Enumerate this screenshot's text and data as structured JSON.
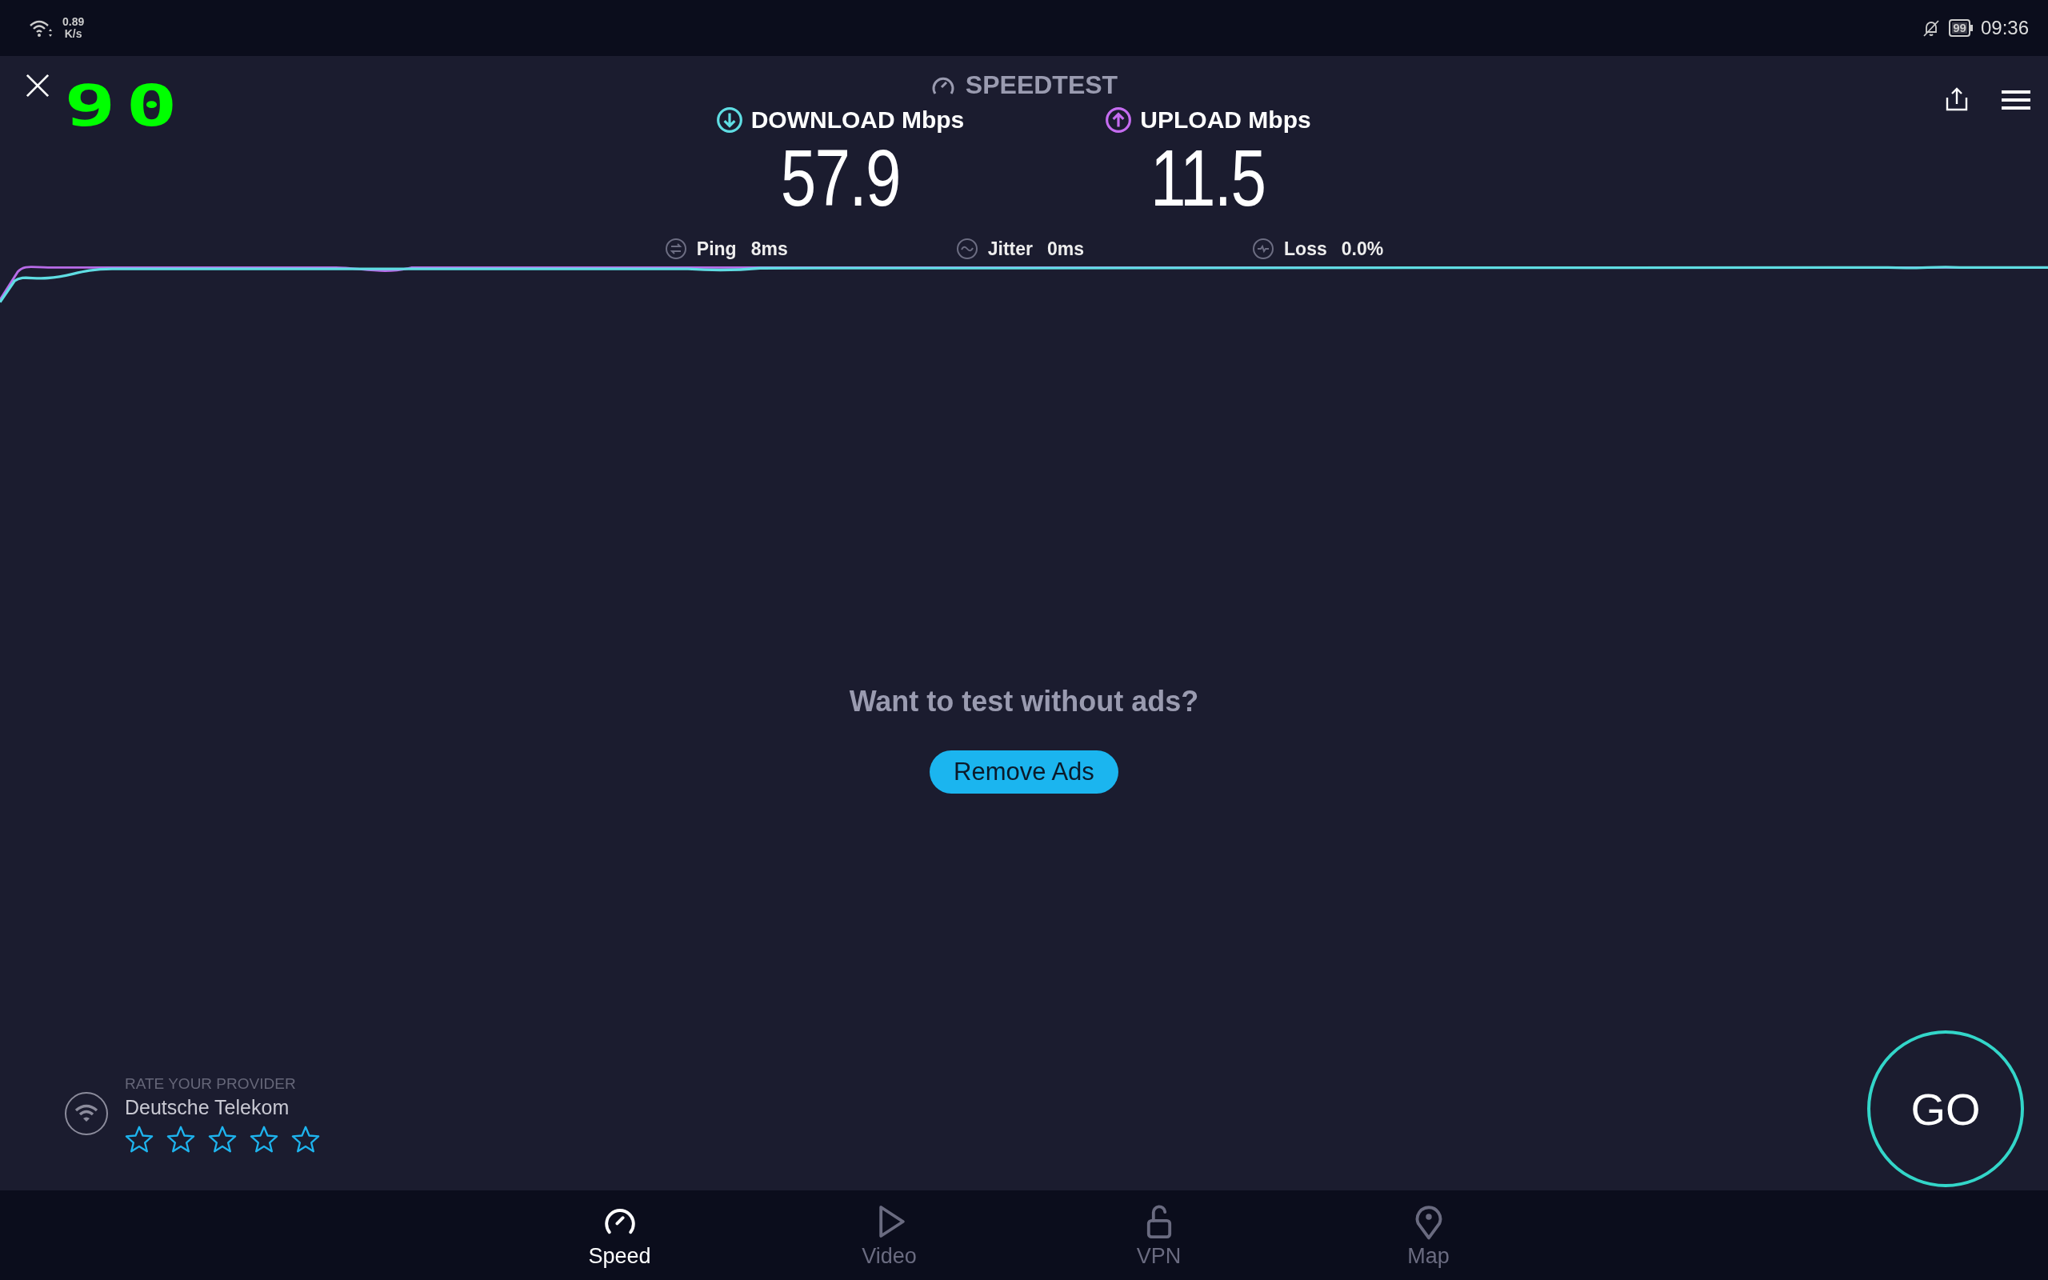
{
  "status_bar": {
    "net_speed": "0.89",
    "net_unit": "K/s",
    "battery": "99",
    "time": "09:36"
  },
  "fps_counter": "90",
  "title": "SPEEDTEST",
  "results": [
    {
      "kind": "download",
      "label": "DOWNLOAD Mbps",
      "value": "57.9"
    },
    {
      "kind": "upload",
      "label": "UPLOAD Mbps",
      "value": "11.5"
    }
  ],
  "stats": [
    {
      "kind": "ping",
      "label": "Ping",
      "value": "8ms"
    },
    {
      "kind": "jitter",
      "label": "Jitter",
      "value": "0ms"
    },
    {
      "kind": "loss",
      "label": "Loss",
      "value": "0.0%"
    }
  ],
  "ads": {
    "prompt": "Want to test without ads?",
    "button": "Remove Ads"
  },
  "provider": {
    "heading": "RATE YOUR PROVIDER",
    "name": "Deutsche Telekom",
    "stars": 0
  },
  "go_button": "GO",
  "nav": [
    {
      "kind": "speed",
      "label": "Speed",
      "selected": true
    },
    {
      "kind": "video",
      "label": "Video",
      "selected": false
    },
    {
      "kind": "vpn",
      "label": "VPN",
      "selected": false
    },
    {
      "kind": "map",
      "label": "Map",
      "selected": false
    }
  ]
}
